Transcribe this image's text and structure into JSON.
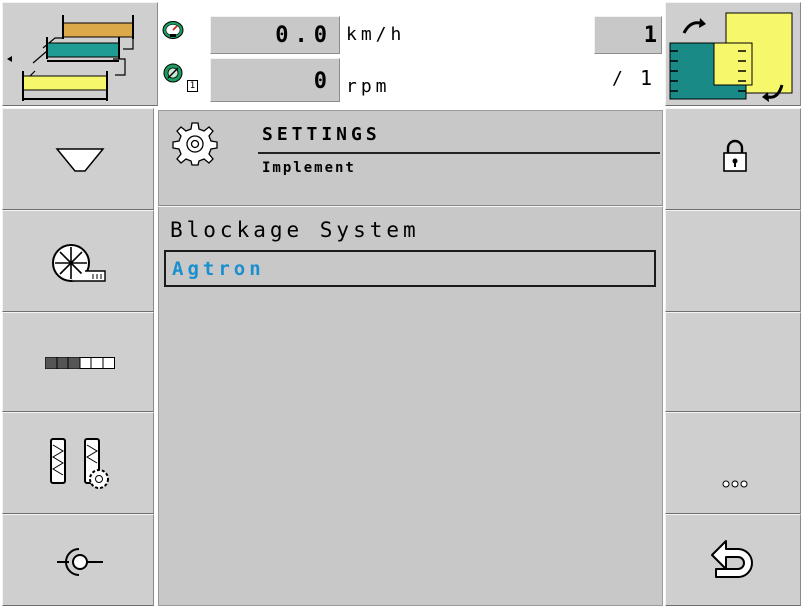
{
  "speed": {
    "value": "0.0",
    "unit": "km/h"
  },
  "rpm": {
    "value": "0",
    "unit": "rpm"
  },
  "counter": {
    "value": "1",
    "denominator": "1"
  },
  "screen": {
    "title": "SETTINGS",
    "subtitle": "Implement"
  },
  "setting": {
    "label": "Blockage System",
    "value": "Agtron"
  },
  "rpm_badge": "1",
  "colors": {
    "accent_blue": "#1a8fd0",
    "yellow": "#f7f76b",
    "teal": "#1a8a86",
    "panel_grey": "#c8c8c8"
  }
}
